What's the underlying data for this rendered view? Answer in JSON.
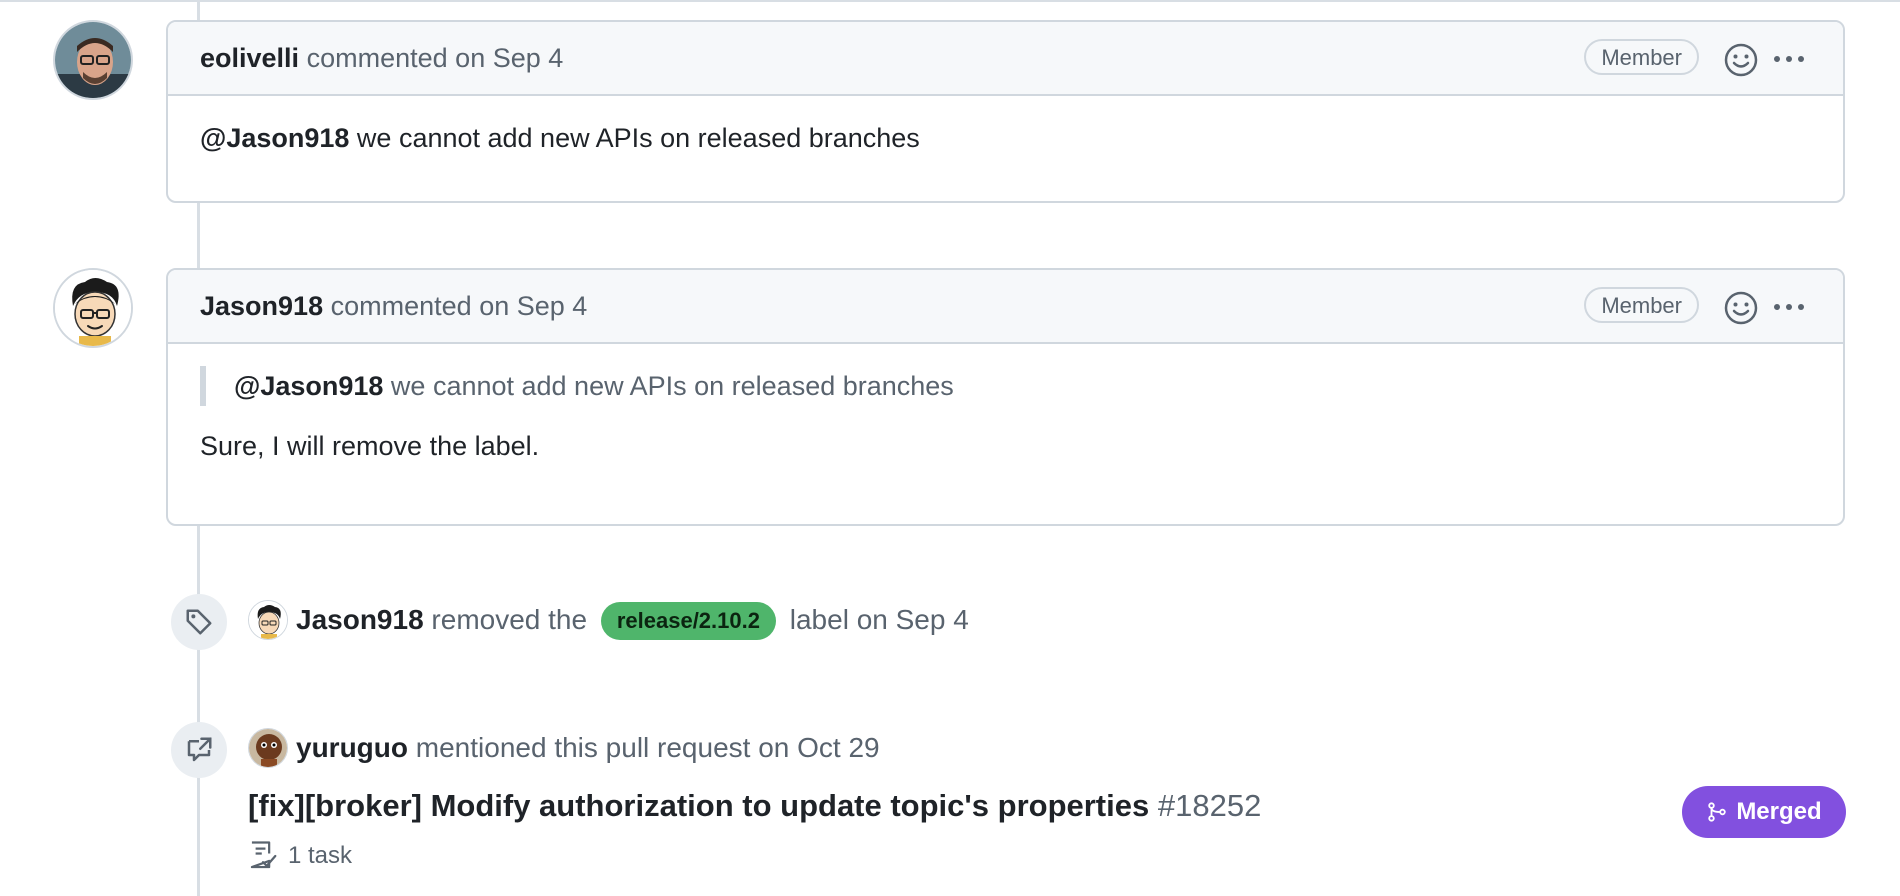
{
  "comments": [
    {
      "author": "eolivelli",
      "action": "commented",
      "date": "on Sep 4",
      "badge": "Member",
      "body_mention": "@Jason918",
      "body_text": " we cannot add new APIs on released branches"
    },
    {
      "author": "Jason918",
      "action": "commented",
      "date": "on Sep 4",
      "badge": "Member",
      "quote_mention": "@Jason918",
      "quote_text": " we cannot add new APIs on released branches",
      "body_text": "Sure, I will remove the label."
    }
  ],
  "label_event": {
    "actor": "Jason918",
    "pre": "removed the",
    "label": "release/2.10.2",
    "post": "label on Sep 4"
  },
  "mention_event": {
    "actor": "yuruguo",
    "text": "mentioned this pull request on Oct 29",
    "pr_title": "[fix][broker] Modify authorization to update topic's properties",
    "pr_number": "#18252",
    "status": "Merged",
    "tasks": "1 task"
  },
  "colors": {
    "merged": "#8250df",
    "label": "#4fb56b",
    "border": "#d0d7de"
  }
}
